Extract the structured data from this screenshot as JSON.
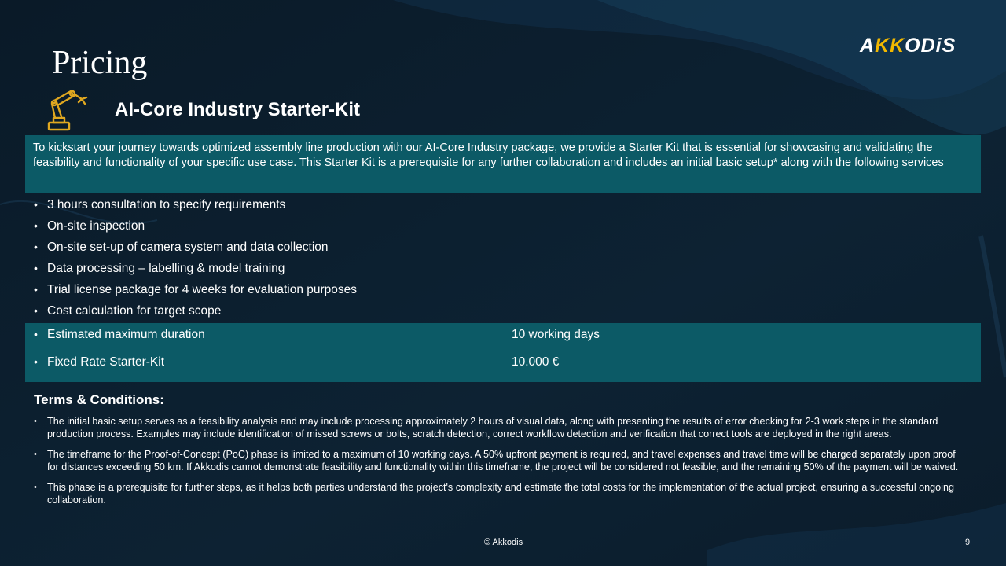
{
  "page": {
    "title": "Pricing",
    "logo_text_a": "A",
    "logo_text_kk": "KK",
    "logo_text_rest": "ODiS",
    "accent_color": "#f2b800",
    "teal_color": "#0c5a66"
  },
  "kit": {
    "icon": "robot-arm-icon",
    "title": "AI-Core Industry Starter-Kit",
    "intro": "To kickstart your journey towards optimized assembly line production with our AI-Core Industry package, we provide a Starter Kit that is essential for showcasing and validating the feasibility and functionality of your specific use case. This Starter Kit is a prerequisite for any further collaboration and includes an initial basic setup* along with the following services"
  },
  "services": [
    "3 hours consultation to specify requirements",
    "On-site inspection",
    "On-site set-up of camera system and data collection",
    "Data processing – labelling & model training",
    "Trial license package for 4 weeks for evaluation purposes",
    "Cost calculation for target scope"
  ],
  "estimates": [
    {
      "label": "Estimated maximum duration",
      "value": "10 working days"
    },
    {
      "label": "Fixed Rate Starter-Kit",
      "value": "10.000 €"
    }
  ],
  "terms": {
    "title": "Terms & Conditions:",
    "items": [
      "The initial basic setup serves as a feasibility analysis and may include processing approximately 2 hours of visual data, along with presenting the results of error checking for 2-3 work steps in the standard production process. Examples may include identification of missed screws or bolts, scratch detection, correct workflow detection and verification that correct tools are deployed in the right areas.",
      "The timeframe for the Proof-of-Concept (PoC) phase is limited to a maximum of 10 working days. A 50% upfront payment is required, and travel expenses and travel time will be charged separately upon proof for distances exceeding 50 km. If Akkodis cannot demonstrate feasibility and functionality within this timeframe, the project will be considered not feasible, and the remaining 50% of the payment will be waived.",
      "This phase is a prerequisite for further steps, as it helps both parties understand the project's complexity and estimate the total costs for the implementation of the actual project, ensuring a successful ongoing collaboration."
    ]
  },
  "footer": {
    "copyright": "© Akkodis",
    "page_number": "9"
  },
  "bullet_char": "•"
}
